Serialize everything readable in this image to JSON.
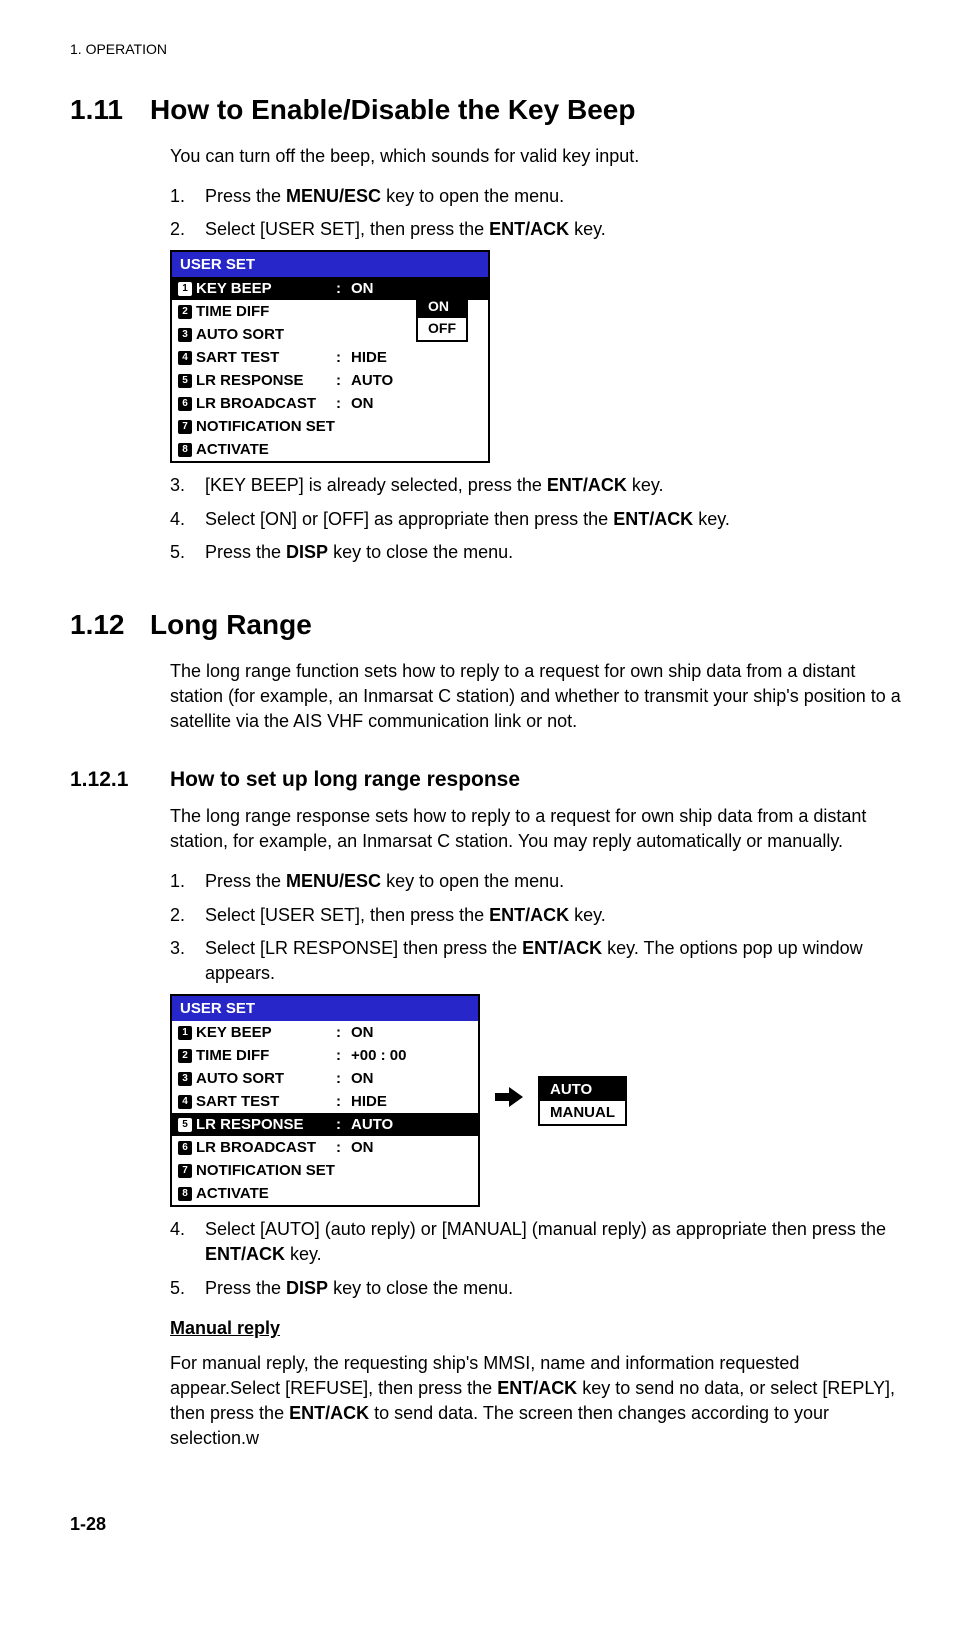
{
  "header": "1.  OPERATION",
  "section111": {
    "number": "1.11",
    "title": "How to Enable/Disable the Key Beep",
    "intro": "You can turn off the beep, which sounds for valid key input.",
    "steps": [
      {
        "n": "1.",
        "pre": "Press the ",
        "bold1": "MENU/ESC",
        "post1": " key to open the menu."
      },
      {
        "n": "2.",
        "pre": "Select [USER SET], then press the ",
        "bold1": "ENT/ACK",
        "post1": " key."
      },
      {
        "n": "3.",
        "pre": "[KEY BEEP] is already selected, press the ",
        "bold1": "ENT/ACK",
        "post1": " key."
      },
      {
        "n": "4.",
        "pre": "Select [ON] or [OFF] as appropriate then press the ",
        "bold1": "ENT/ACK",
        "post1": " key."
      },
      {
        "n": "5.",
        "pre": "Press the ",
        "bold1": "DISP",
        "post1": " key to close the menu."
      }
    ]
  },
  "menu1": {
    "title": "USER SET",
    "items": [
      {
        "num": "1",
        "label": "KEY BEEP",
        "colon": ":",
        "value": "ON",
        "selected": true
      },
      {
        "num": "2",
        "label": "TIME DIFF",
        "colon": "",
        "value": ""
      },
      {
        "num": "3",
        "label": "AUTO SORT",
        "colon": "",
        "value": ""
      },
      {
        "num": "4",
        "label": "SART TEST",
        "colon": ":",
        "value": "HIDE"
      },
      {
        "num": "5",
        "label": "LR RESPONSE",
        "colon": ":",
        "value": "AUTO"
      },
      {
        "num": "6",
        "label": "LR BROADCAST",
        "colon": ":",
        "value": "ON"
      },
      {
        "num": "7",
        "label": "NOTIFICATION SET",
        "colon": "",
        "value": ""
      },
      {
        "num": "8",
        "label": "ACTIVATE",
        "colon": "",
        "value": ""
      }
    ],
    "dropdown": {
      "options": [
        {
          "label": "ON",
          "selected": true
        },
        {
          "label": "OFF",
          "selected": false
        }
      ]
    }
  },
  "section112": {
    "number": "1.12",
    "title": "Long Range",
    "intro": "The long range function sets how to reply to a request for own ship data from a distant station (for example, an Inmarsat C station) and whether to transmit your ship's position to a satellite via the AIS VHF communication link or not."
  },
  "subsection1121": {
    "number": "1.12.1",
    "title": "How to set up long range response",
    "intro": "The long range response sets how to reply to a request for own ship data from a distant station, for example, an Inmarsat C station. You may reply automatically or manually.",
    "steps": [
      {
        "n": "1.",
        "pre": "Press the ",
        "bold1": "MENU/ESC",
        "post1": " key to open the menu."
      },
      {
        "n": "2.",
        "pre": "Select [USER SET], then press the ",
        "bold1": "ENT/ACK",
        "post1": " key."
      },
      {
        "n": "3.",
        "pre": "Select [LR RESPONSE] then press the ",
        "bold1": "ENT/ACK",
        "post1": " key. The options pop up window appears."
      },
      {
        "n": "4.",
        "pre": "Select [AUTO] (auto reply) or [MANUAL] (manual reply) as appropriate then press the ",
        "bold1": "ENT/ACK",
        "post1": " key."
      },
      {
        "n": "5.",
        "pre": "Press the ",
        "bold1": "DISP",
        "post1": " key to close the menu."
      }
    ],
    "manualReplyHeading": "Manual reply",
    "manualReply": {
      "p1a": "For manual reply, the requesting ship's MMSI, name and information requested appear.Select [REFUSE], then press the ",
      "b1": "ENT/ACK",
      "p1b": " key to send no data, or select [REPLY], then press the ",
      "b2": "ENT/ACK",
      "p1c": " to send data. The screen then changes according to your selection.w"
    }
  },
  "menu2": {
    "title": "USER SET",
    "items": [
      {
        "num": "1",
        "label": "KEY BEEP",
        "colon": ":",
        "value": "ON"
      },
      {
        "num": "2",
        "label": "TIME DIFF",
        "colon": ":",
        "value": "+00 : 00"
      },
      {
        "num": "3",
        "label": "AUTO SORT",
        "colon": ":",
        "value": "ON"
      },
      {
        "num": "4",
        "label": "SART TEST",
        "colon": ":",
        "value": "HIDE"
      },
      {
        "num": "5",
        "label": "LR RESPONSE",
        "colon": ":",
        "value": "AUTO",
        "selected": true
      },
      {
        "num": "6",
        "label": "LR BROADCAST",
        "colon": ":",
        "value": "ON"
      },
      {
        "num": "7",
        "label": "NOTIFICATION SET",
        "colon": "",
        "value": ""
      },
      {
        "num": "8",
        "label": "ACTIVATE",
        "colon": "",
        "value": ""
      }
    ],
    "popup": {
      "options": [
        {
          "label": "AUTO",
          "selected": true
        },
        {
          "label": "MANUAL",
          "selected": false
        }
      ]
    }
  },
  "pageNumber": "1-28"
}
